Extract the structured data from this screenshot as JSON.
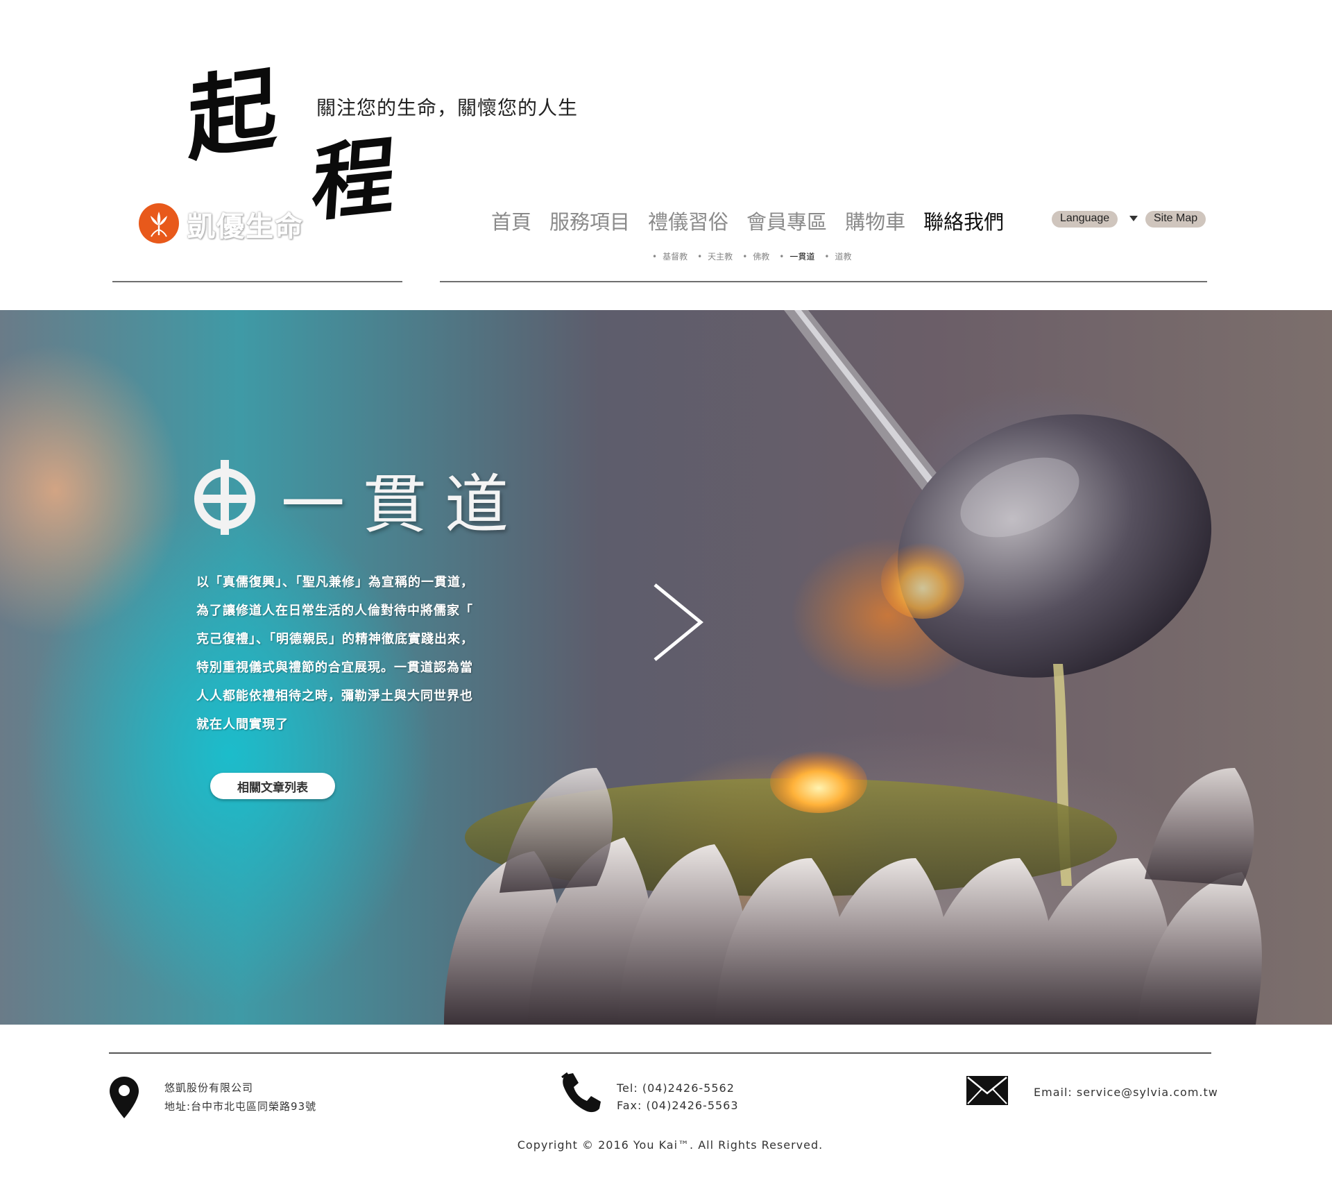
{
  "header": {
    "logo_calligraphy": [
      "起",
      "程"
    ],
    "tagline": "關注您的生命，關懷您的人生",
    "brand_name": "凱優生命",
    "brand_color": "#e8591b"
  },
  "nav": {
    "items": [
      "首頁",
      "服務項目",
      "禮儀習俗",
      "會員專區",
      "購物車",
      "聯絡我們"
    ],
    "active_index": 5
  },
  "subnav": {
    "items": [
      "基督教",
      "天主教",
      "佛教",
      "一貫道",
      "道教"
    ],
    "active_index": 3
  },
  "language_button": "Language",
  "sitemap_button": "Site Map",
  "icons": {
    "logo": "orchid-logo-icon",
    "dropdown": "caret-down-icon",
    "emblem": "yiguandao-emblem-icon",
    "next": "chevron-right-icon",
    "location": "map-pin-icon",
    "phone": "phone-icon",
    "mail": "envelope-icon"
  },
  "hero": {
    "title": "一貫道",
    "description": [
      "以「真儒復興」、「聖凡兼修」為宣稱的一貫道，",
      "為了讓修道人在日常生活的人倫對待中將儒家「",
      "克己復禮」、「明德親民」的精神徹底實踐出來，",
      "特別重視儀式與禮節的合宜展現。一貫道認為當",
      "人人都能依禮相待之時，彌勒淨土與大同世界也",
      "就在人間實現了"
    ],
    "cta_label": "相關文章列表"
  },
  "footer": {
    "company_name": "悠凱股份有限公司",
    "address": "地址:台中市北屯區同榮路93號",
    "tel": "Tel: (04)2426-5562",
    "fax": "Fax: (04)2426-5563",
    "email": "Email: service@sylvia.com.tw",
    "copyright": "Copyright © 2016 You Kai™. All Rights Reserved."
  }
}
